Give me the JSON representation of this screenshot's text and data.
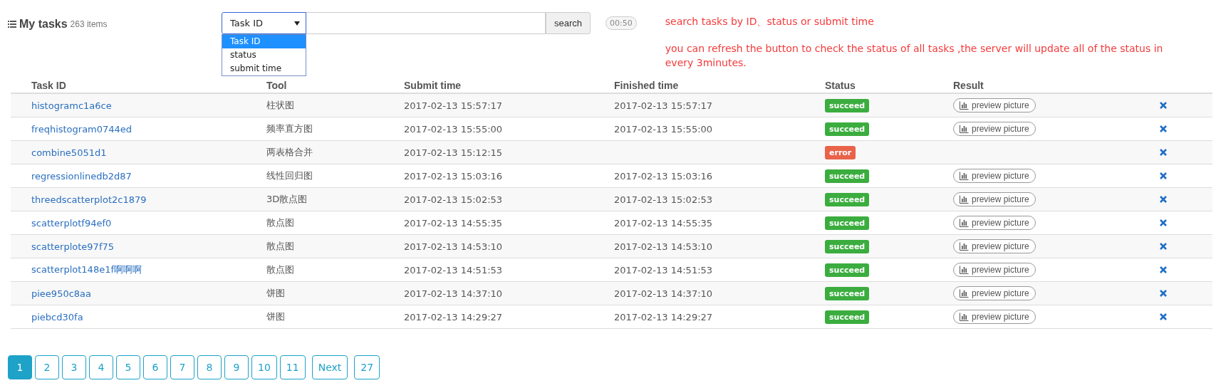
{
  "header": {
    "title": "My tasks",
    "count": "263 items"
  },
  "search": {
    "field_select": "Task ID",
    "options": [
      {
        "label": "Task ID",
        "selected": true
      },
      {
        "label": "status",
        "selected": false
      },
      {
        "label": "submit time",
        "selected": false
      }
    ],
    "button": "search",
    "timer": "00:50"
  },
  "notes": [
    "search tasks by ID、status or submit time",
    "you can refresh the button to check the status of  all tasks ,the server will update all of the status in every 3minutes."
  ],
  "table": {
    "columns": [
      "Task ID",
      "Tool",
      "Submit time",
      "Finished time",
      "Status",
      "Result"
    ],
    "rows": [
      {
        "task_id": "histogramc1a6ce",
        "tool": "柱状图",
        "submit_time": "2017-02-13 15:57:17",
        "finished_time": "2017-02-13 15:57:17",
        "status": "succeed",
        "kind": "success",
        "result": "preview picture"
      },
      {
        "task_id": "freqhistogram0744ed",
        "tool": "频率直方图",
        "submit_time": "2017-02-13 15:55:00",
        "finished_time": "2017-02-13 15:55:00",
        "status": "succeed",
        "kind": "success",
        "result": "preview picture"
      },
      {
        "task_id": "combine5051d1",
        "tool": "两表格合并",
        "submit_time": "2017-02-13 15:12:15",
        "status": "error",
        "kind": "error"
      },
      {
        "task_id": "regressionlinedb2d87",
        "tool": "线性回归图",
        "submit_time": "2017-02-13 15:03:16",
        "finished_time": "2017-02-13 15:03:16",
        "status": "succeed",
        "kind": "success",
        "result": "preview picture"
      },
      {
        "task_id": "threedscatterplot2c1879",
        "tool": "3D散点图",
        "submit_time": "2017-02-13 15:02:53",
        "finished_time": "2017-02-13 15:02:53",
        "status": "succeed",
        "kind": "success",
        "result": "preview picture"
      },
      {
        "task_id": "scatterplotf94ef0",
        "tool": "散点图",
        "submit_time": "2017-02-13 14:55:35",
        "finished_time": "2017-02-13 14:55:35",
        "status": "succeed",
        "kind": "success",
        "result": "preview picture"
      },
      {
        "task_id": "scatterplote97f75",
        "tool": "散点图",
        "submit_time": "2017-02-13 14:53:10",
        "finished_time": "2017-02-13 14:53:10",
        "status": "succeed",
        "kind": "success",
        "result": "preview picture"
      },
      {
        "task_id": "scatterplot148e1f啊啊啊",
        "tool": "散点图",
        "submit_time": "2017-02-13 14:51:53",
        "finished_time": "2017-02-13 14:51:53",
        "status": "succeed",
        "kind": "success",
        "result": "preview picture"
      },
      {
        "task_id": "piee950c8aa",
        "tool": "饼图",
        "submit_time": "2017-02-13 14:37:10",
        "finished_time": "2017-02-13 14:37:10",
        "status": "succeed",
        "kind": "success",
        "result": "preview picture"
      },
      {
        "task_id": "piebcd30fa",
        "tool": "饼图",
        "submit_time": "2017-02-13 14:29:27",
        "finished_time": "2017-02-13 14:29:27",
        "status": "succeed",
        "kind": "success",
        "result": "preview picture"
      }
    ]
  },
  "pagination": [
    {
      "label": "1",
      "selected": true
    },
    {
      "label": "2",
      "selected": false
    },
    {
      "label": "3",
      "selected": false
    },
    {
      "label": "4",
      "selected": false
    },
    {
      "label": "5",
      "selected": false
    },
    {
      "label": "6",
      "selected": false
    },
    {
      "label": "7",
      "selected": false
    },
    {
      "label": "8",
      "selected": false
    },
    {
      "label": "9",
      "selected": false
    },
    {
      "label": "10",
      "selected": false
    },
    {
      "label": "11",
      "selected": false
    },
    {
      "label": "Next",
      "selected": false
    },
    {
      "label": "27",
      "selected": false
    }
  ]
}
